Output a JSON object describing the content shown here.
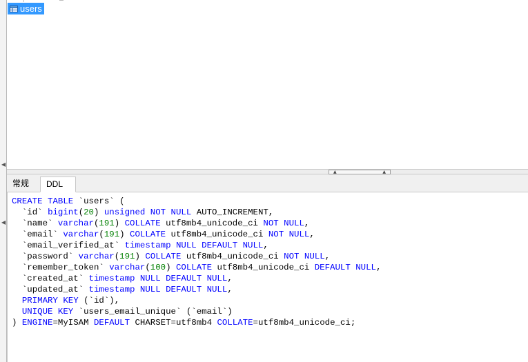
{
  "tree": {
    "selected_table": "users"
  },
  "tabs": [
    {
      "label": "常规"
    },
    {
      "label": "DDL"
    }
  ],
  "ddl": {
    "lines": [
      [
        [
          "kw",
          "CREATE TABLE "
        ],
        [
          "t",
          "`users` ("
        ]
      ],
      [
        [
          "t",
          "  `id` "
        ],
        [
          "kw",
          "bigint"
        ],
        [
          "t",
          "("
        ],
        [
          "num",
          "20"
        ],
        [
          "t",
          ") "
        ],
        [
          "kw",
          "unsigned NOT NULL "
        ],
        [
          "t",
          "AUTO_INCREMENT,"
        ]
      ],
      [
        [
          "t",
          "  `name` "
        ],
        [
          "kw",
          "varchar"
        ],
        [
          "t",
          "("
        ],
        [
          "num",
          "191"
        ],
        [
          "t",
          ") "
        ],
        [
          "kw",
          "COLLATE "
        ],
        [
          "t",
          "utf8mb4_unicode_ci "
        ],
        [
          "kw",
          "NOT NULL"
        ],
        [
          "t",
          ","
        ]
      ],
      [
        [
          "t",
          "  `email` "
        ],
        [
          "kw",
          "varchar"
        ],
        [
          "t",
          "("
        ],
        [
          "num",
          "191"
        ],
        [
          "t",
          ") "
        ],
        [
          "kw",
          "COLLATE "
        ],
        [
          "t",
          "utf8mb4_unicode_ci "
        ],
        [
          "kw",
          "NOT NULL"
        ],
        [
          "t",
          ","
        ]
      ],
      [
        [
          "t",
          "  `email_verified_at` "
        ],
        [
          "kw",
          "timestamp NULL DEFAULT NULL"
        ],
        [
          "t",
          ","
        ]
      ],
      [
        [
          "t",
          "  `password` "
        ],
        [
          "kw",
          "varchar"
        ],
        [
          "t",
          "("
        ],
        [
          "num",
          "191"
        ],
        [
          "t",
          ") "
        ],
        [
          "kw",
          "COLLATE "
        ],
        [
          "t",
          "utf8mb4_unicode_ci "
        ],
        [
          "kw",
          "NOT NULL"
        ],
        [
          "t",
          ","
        ]
      ],
      [
        [
          "t",
          "  `remember_token` "
        ],
        [
          "kw",
          "varchar"
        ],
        [
          "t",
          "("
        ],
        [
          "num",
          "100"
        ],
        [
          "t",
          ") "
        ],
        [
          "kw",
          "COLLATE "
        ],
        [
          "t",
          "utf8mb4_unicode_ci "
        ],
        [
          "kw",
          "DEFAULT NULL"
        ],
        [
          "t",
          ","
        ]
      ],
      [
        [
          "t",
          "  `created_at` "
        ],
        [
          "kw",
          "timestamp NULL DEFAULT NULL"
        ],
        [
          "t",
          ","
        ]
      ],
      [
        [
          "t",
          "  `updated_at` "
        ],
        [
          "kw",
          "timestamp NULL DEFAULT NULL"
        ],
        [
          "t",
          ","
        ]
      ],
      [
        [
          "t",
          "  "
        ],
        [
          "kw",
          "PRIMARY KEY "
        ],
        [
          "t",
          "(`id`),"
        ]
      ],
      [
        [
          "t",
          "  "
        ],
        [
          "kw",
          "UNIQUE KEY "
        ],
        [
          "t",
          "`users_email_unique` (`email`)"
        ]
      ],
      [
        [
          "t",
          ") "
        ],
        [
          "kw",
          "ENGINE"
        ],
        [
          "t",
          "=MyISAM "
        ],
        [
          "kw",
          "DEFAULT "
        ],
        [
          "t",
          "CHARSET=utf8mb4 "
        ],
        [
          "kw",
          "COLLATE"
        ],
        [
          "t",
          "=utf8mb4_unicode_ci;"
        ]
      ]
    ]
  },
  "colors": {
    "selection": "#3399ff",
    "keyword": "#0000ff",
    "number": "#008000"
  },
  "icons": [
    "table-icon",
    "collapse-left-arrow-icon",
    "splitter-up-arrow-icon"
  ]
}
